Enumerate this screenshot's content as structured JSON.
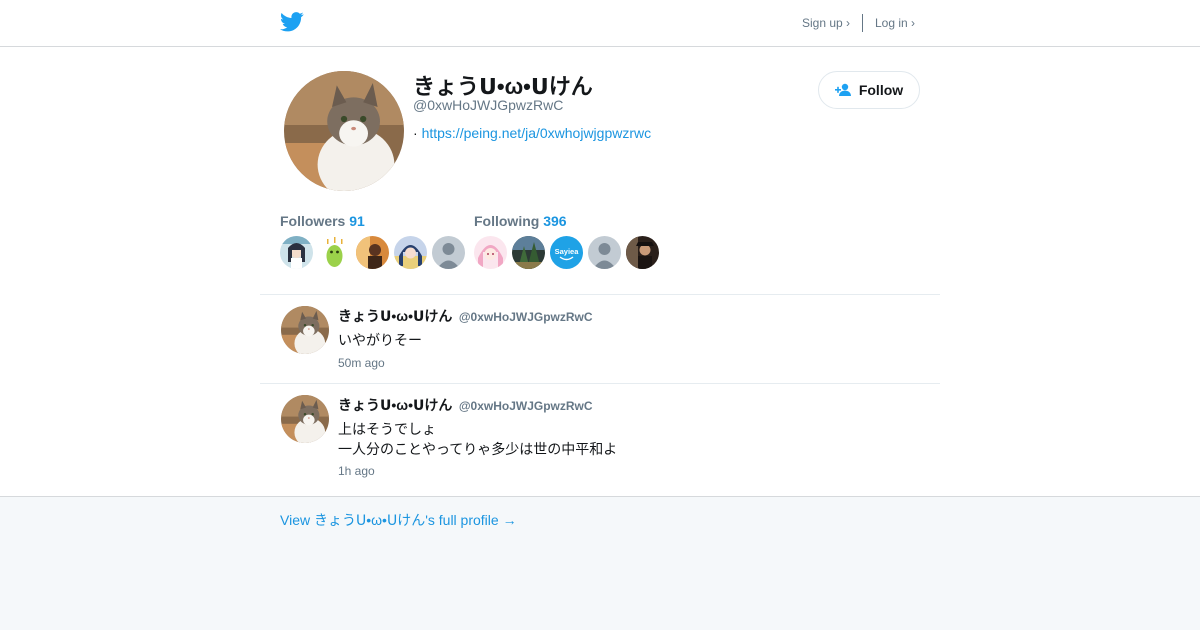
{
  "header": {
    "logo": "twitter-bird-icon",
    "signup_label": "Sign up ›",
    "login_label": "Log in ›"
  },
  "profile": {
    "display_name": "きょうᑌ•ω•ᑌけん",
    "handle": "@0xwHoJWJGpwzRwC",
    "bio_prefix": "·",
    "bio_link": "https://peing.net/ja/0xwhojwjgpwzrwc",
    "follow_label": "Follow",
    "follow_icon": "add-user-icon"
  },
  "stats": {
    "followers_label": "Followers",
    "followers_count": "91",
    "following_label": "Following",
    "following_count": "396"
  },
  "follower_faces": [
    "anime-girl-avatar",
    "green-character-avatar",
    "person-avatar",
    "anime-girl-avatar",
    "default-avatar"
  ],
  "following_faces": [
    "anime-girl-avatar",
    "landscape-avatar",
    "sayiea-logo-avatar",
    "default-avatar",
    "person-avatar"
  ],
  "badge_text": "Sayiea",
  "tweets": [
    {
      "name": "きょうᑌ•ω•ᑌけん",
      "handle": "@0xwHoJWJGpwzRwC",
      "line1": "いやがりそー",
      "line2": "",
      "time": "50m ago"
    },
    {
      "name": "きょうᑌ•ω•ᑌけん",
      "handle": "@0xwHoJWJGpwzRwC",
      "line1": "上はそうでしょ",
      "line2": "一人分のことやってりゃ多少は世の中平和よ",
      "time": "1h ago"
    }
  ],
  "footer": {
    "view_full_label": "View きょうᑌ•ω•ᑌけん's full profile →"
  },
  "colors": {
    "accent": "#1b95e0",
    "twitter_blue": "#1da1f2",
    "muted": "#657786",
    "background": "#f5f8fa"
  }
}
